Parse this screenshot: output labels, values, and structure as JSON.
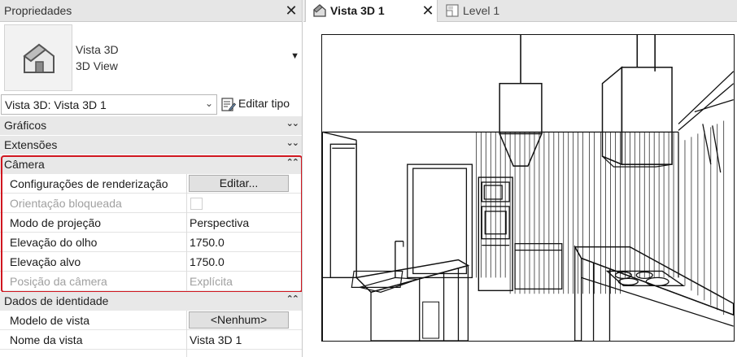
{
  "properties": {
    "title": "Propriedades",
    "type_selector": {
      "line1": "Vista 3D",
      "line2": "3D View"
    },
    "view_instance": "Vista 3D: Vista 3D 1",
    "edit_type_label": "Editar tipo",
    "categories": {
      "graphics": "Gráficos",
      "extents": "Extensões",
      "camera": "Câmera",
      "identity": "Dados de identidade"
    },
    "camera": {
      "render_settings": {
        "name": "Configurações de renderização",
        "value": "Editar..."
      },
      "locked_orientation": {
        "name": "Orientação bloqueada",
        "checked": false
      },
      "projection_mode": {
        "name": "Modo de projeção",
        "value": "Perspectiva"
      },
      "eye_elevation": {
        "name": "Elevação do olho",
        "value": "1750.0"
      },
      "target_elevation": {
        "name": "Elevação alvo",
        "value": "1750.0"
      },
      "camera_position": {
        "name": "Posição da câmera",
        "value": "Explícita"
      }
    },
    "identity": {
      "view_template": {
        "name": "Modelo de vista",
        "value": "<Nenhum>"
      },
      "view_name": {
        "name": "Nome da vista",
        "value": "Vista 3D 1"
      }
    }
  },
  "tabs": [
    {
      "label": "Vista 3D 1",
      "active": true
    },
    {
      "label": "Level 1",
      "active": false
    }
  ],
  "colors": {
    "highlight": "#d0161f",
    "panel_header": "#e6e6e6",
    "category_bg": "#e8e8e8"
  },
  "icons": [
    "close-icon",
    "house-3d-icon",
    "dropdown-arrow-icon",
    "edit-type-icon",
    "double-chevron-down-icon",
    "double-chevron-up-icon",
    "plan-view-icon"
  ]
}
